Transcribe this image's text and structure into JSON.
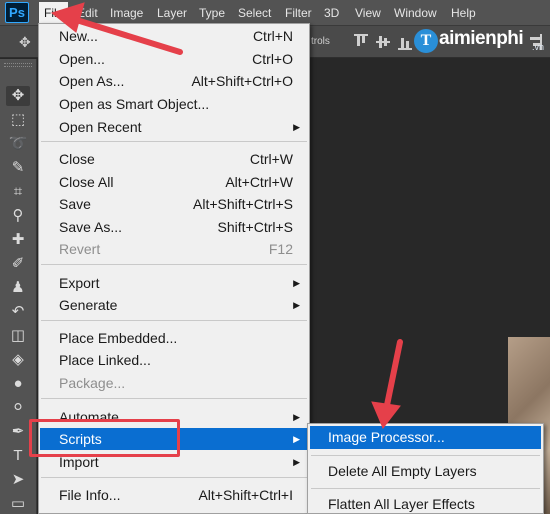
{
  "app": {
    "logo": "Ps"
  },
  "menubar": {
    "items": [
      "File",
      "Edit",
      "Image",
      "Layer",
      "Type",
      "Select",
      "Filter",
      "3D",
      "View",
      "Window",
      "Help"
    ]
  },
  "optionsbar": {
    "move_icon": "move-icon",
    "controls_text": "trols",
    "watermark": {
      "brand": "aimienphi",
      "initial": "T",
      "suffix": ".vn"
    }
  },
  "file_menu": {
    "items": [
      {
        "label": "New...",
        "shortcut": "Ctrl+N"
      },
      {
        "label": "Open...",
        "shortcut": "Ctrl+O"
      },
      {
        "label": "Open As...",
        "shortcut": "Alt+Shift+Ctrl+O"
      },
      {
        "label": "Open as Smart Object...",
        "shortcut": ""
      },
      {
        "label": "Open Recent",
        "shortcut": "",
        "submenu": true
      },
      {
        "label": "Close",
        "shortcut": "Ctrl+W"
      },
      {
        "label": "Close All",
        "shortcut": "Alt+Ctrl+W"
      },
      {
        "label": "Save",
        "shortcut": "Alt+Shift+Ctrl+S"
      },
      {
        "label": "Save As...",
        "shortcut": "Shift+Ctrl+S"
      },
      {
        "label": "Revert",
        "shortcut": "F12",
        "disabled": true
      },
      {
        "label": "Export",
        "shortcut": "",
        "submenu": true
      },
      {
        "label": "Generate",
        "shortcut": "",
        "submenu": true
      },
      {
        "label": "Place Embedded...",
        "shortcut": ""
      },
      {
        "label": "Place Linked...",
        "shortcut": ""
      },
      {
        "label": "Package...",
        "shortcut": "",
        "disabled": true
      },
      {
        "label": "Automate",
        "shortcut": "",
        "submenu": true
      },
      {
        "label": "Scripts",
        "shortcut": "",
        "submenu": true,
        "highlighted": true
      },
      {
        "label": "Import",
        "shortcut": "",
        "submenu": true
      },
      {
        "label": "File Info...",
        "shortcut": "Alt+Shift+Ctrl+I"
      }
    ],
    "submenu_arrow": "▶"
  },
  "scripts_submenu": {
    "items": [
      {
        "label": "Image Processor...",
        "highlighted": true
      },
      {
        "label": "Delete All Empty Layers"
      },
      {
        "label": "Flatten All Layer Effects"
      }
    ]
  },
  "annotations": {
    "arrow_color": "#e5404a",
    "box_color": "#e5404a"
  },
  "colors": {
    "highlight": "#0a6ed1",
    "menu_bg": "#f0f0f0",
    "chrome": "#535353"
  }
}
